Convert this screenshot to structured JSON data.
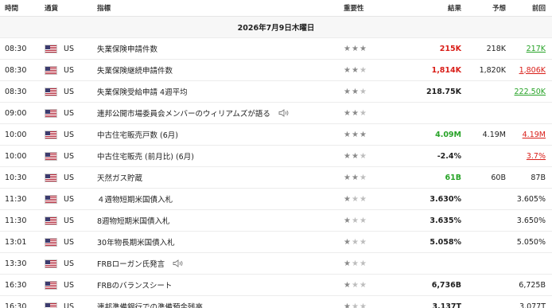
{
  "header": {
    "time": "時間",
    "currency": "通貨",
    "indicator": "指標",
    "importance": "重要性",
    "actual": "結果",
    "forecast": "予想",
    "previous": "前回"
  },
  "date_label": "2026年7月9日木曜日",
  "colors": {
    "positive": "#27a327",
    "negative": "#d91e18"
  },
  "rows": [
    {
      "time": "08:30",
      "currency": "US",
      "indicator": "失業保険申請件数",
      "importance": 3,
      "actual": "215K",
      "actual_color": "red",
      "forecast": "218K",
      "previous": "217K",
      "prev_color": "green",
      "prev_underline": true
    },
    {
      "time": "08:30",
      "currency": "US",
      "indicator": "失業保険継続申請件数",
      "importance": 2,
      "actual": "1,814K",
      "actual_color": "red",
      "forecast": "1,820K",
      "previous": "1,806K",
      "prev_color": "red",
      "prev_underline": true
    },
    {
      "time": "08:30",
      "currency": "US",
      "indicator": "失業保険受給申請 4週平均",
      "importance": 2,
      "actual": "218.75K",
      "actual_color": "",
      "forecast": "",
      "previous": "222.50K",
      "prev_color": "green",
      "prev_underline": true
    },
    {
      "time": "09:00",
      "currency": "US",
      "indicator": "連邦公開市場委員会メンバーのウィリアムズが語る",
      "importance": 2,
      "speech": true,
      "actual": "",
      "forecast": "",
      "previous": ""
    },
    {
      "time": "10:00",
      "currency": "US",
      "indicator": "中古住宅販売戸数 (6月)",
      "importance": 3,
      "actual": "4.09M",
      "actual_color": "green",
      "forecast": "4.19M",
      "previous": "4.19M",
      "prev_color": "red",
      "prev_underline": true
    },
    {
      "time": "10:00",
      "currency": "US",
      "indicator": "中古住宅販売 (前月比) (6月)",
      "importance": 2,
      "actual": "-2.4%",
      "actual_color": "",
      "forecast": "",
      "previous": "3.7%",
      "prev_color": "red",
      "prev_underline": true
    },
    {
      "time": "10:30",
      "currency": "US",
      "indicator": "天然ガス貯蔵",
      "importance": 2,
      "actual": "61B",
      "actual_color": "green",
      "forecast": "60B",
      "previous": "87B"
    },
    {
      "time": "11:30",
      "currency": "US",
      "indicator": "４週物短期米国債入札",
      "importance": 1,
      "actual": "3.630%",
      "actual_color": "",
      "forecast": "",
      "previous": "3.605%"
    },
    {
      "time": "11:30",
      "currency": "US",
      "indicator": "8週物短期米国債入札",
      "importance": 1,
      "actual": "3.635%",
      "actual_color": "",
      "forecast": "",
      "previous": "3.650%"
    },
    {
      "time": "13:01",
      "currency": "US",
      "indicator": "30年物長期米国債入札",
      "importance": 1,
      "actual": "5.058%",
      "actual_color": "",
      "forecast": "",
      "previous": "5.050%"
    },
    {
      "time": "13:30",
      "currency": "US",
      "indicator": "FRBローガン氏発言",
      "importance": 1,
      "speech": true,
      "actual": "",
      "forecast": "",
      "previous": ""
    },
    {
      "time": "16:30",
      "currency": "US",
      "indicator": "FRBのバランスシート",
      "importance": 1,
      "actual": "6,736B",
      "actual_color": "",
      "forecast": "",
      "previous": "6,725B"
    },
    {
      "time": "16:30",
      "currency": "US",
      "indicator": "連邦準備銀行での準備預金残高",
      "importance": 1,
      "actual": "3.137T",
      "actual_color": "",
      "forecast": "",
      "previous": "3.077T"
    }
  ]
}
